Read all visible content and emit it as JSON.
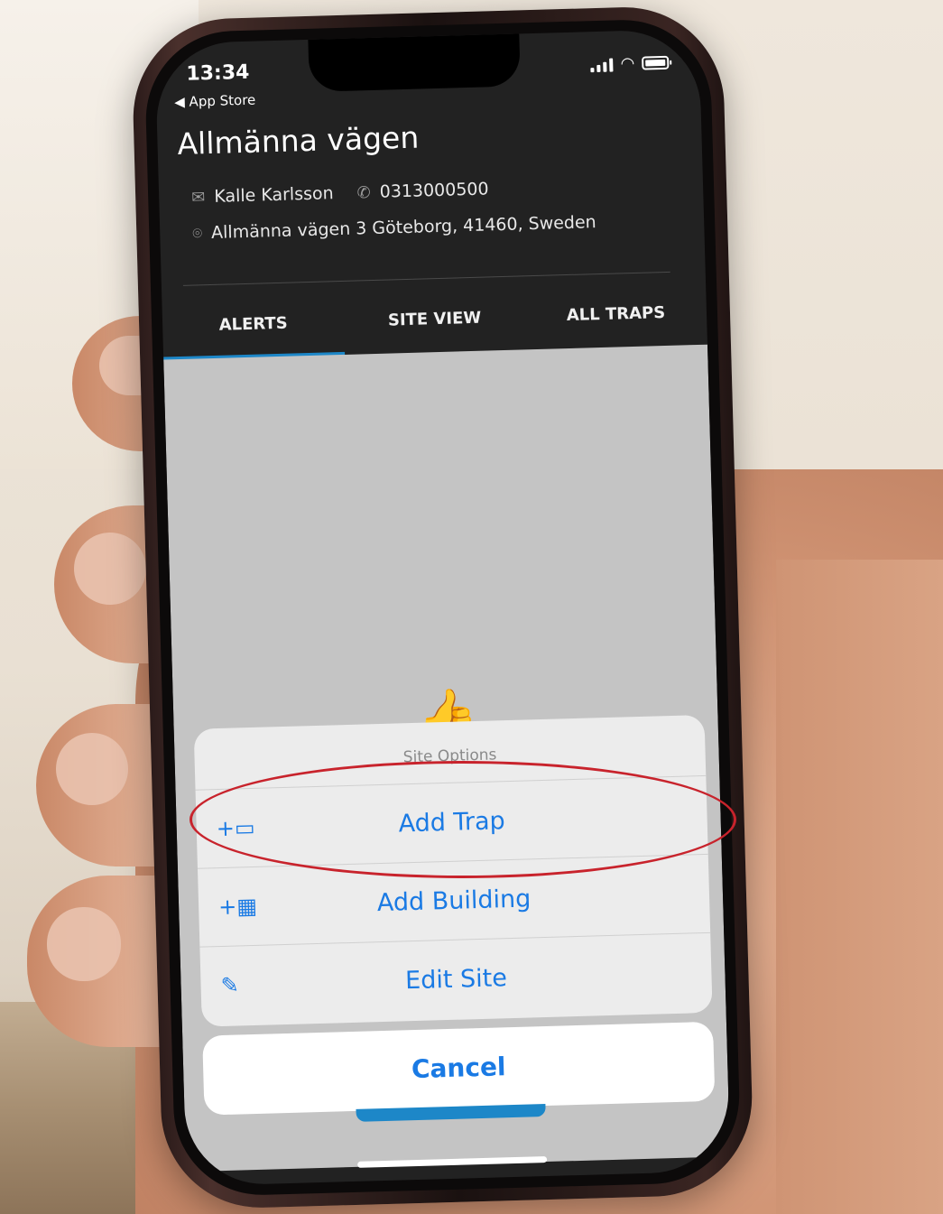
{
  "status_bar": {
    "time": "13:34",
    "back_label": "◀ App Store"
  },
  "site": {
    "title": "Allmänna vägen",
    "contact_name": "Kalle Karlsson",
    "phone": "0313000500",
    "address": "Allmänna vägen 3 Göteborg, 41460, Sweden"
  },
  "tabs": [
    {
      "label": "ALERTS",
      "active": true
    },
    {
      "label": "SITE VIEW",
      "active": false
    },
    {
      "label": "ALL TRAPS",
      "active": false
    }
  ],
  "action_sheet": {
    "title": "Site Options",
    "items": [
      {
        "label": "Add Trap",
        "icon": "add-trap-icon"
      },
      {
        "label": "Add Building",
        "icon": "add-building-icon"
      },
      {
        "label": "Edit Site",
        "icon": "pencil-icon"
      }
    ],
    "cancel_label": "Cancel"
  },
  "colors": {
    "accent": "#1d87c8",
    "action_text": "#1a7ae4",
    "highlight": "#c8232c"
  }
}
